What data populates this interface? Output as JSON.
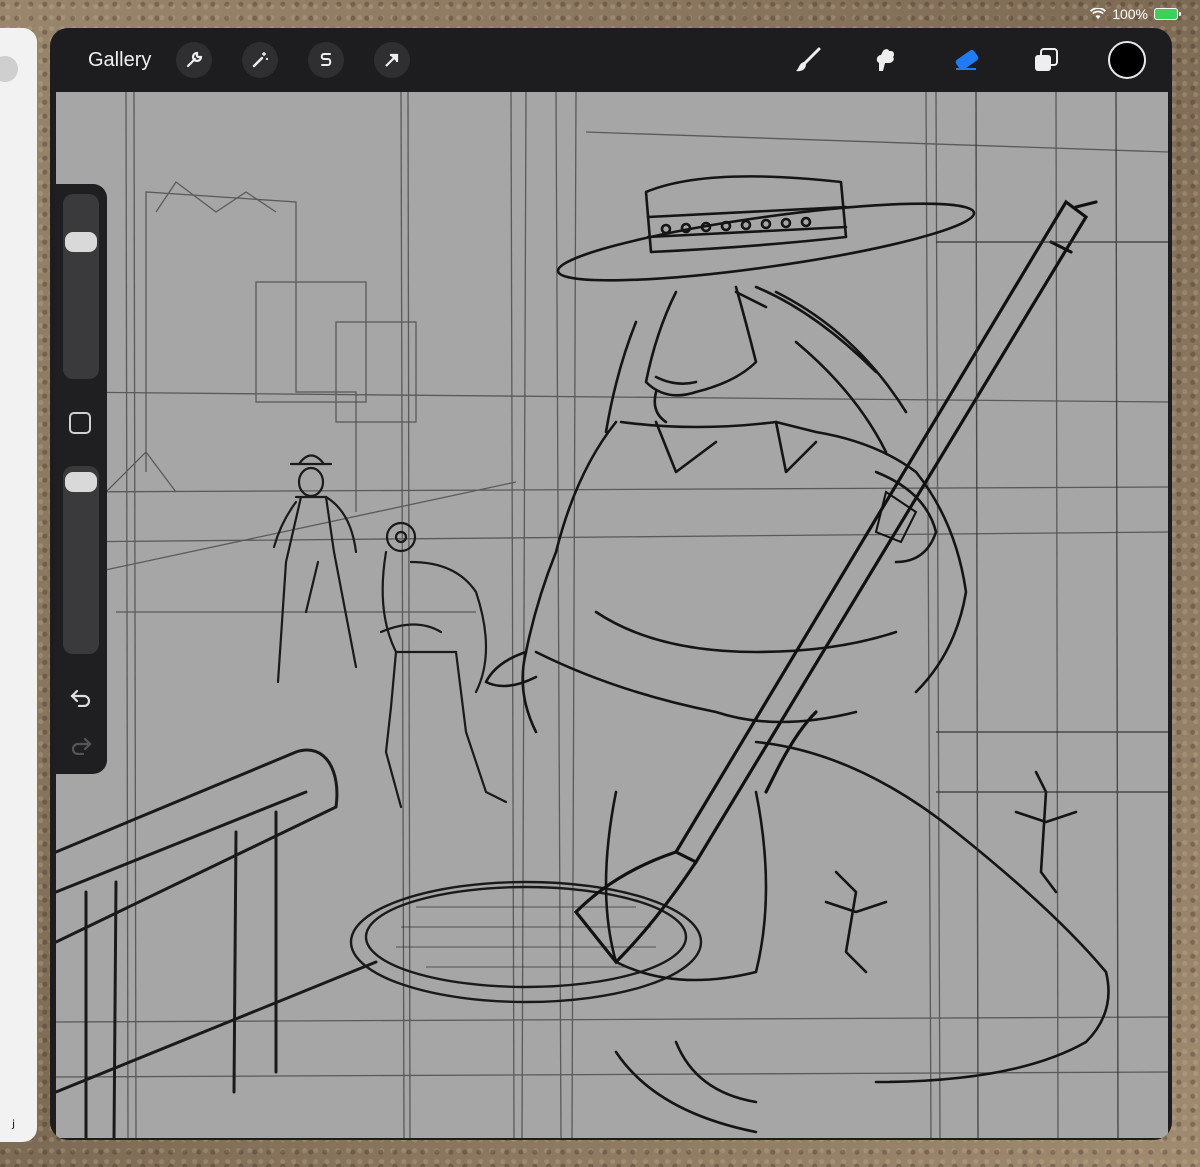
{
  "status_bar": {
    "battery_percent": "100%",
    "wifi_icon": "wifi-icon",
    "battery_icon": "battery-charging-icon"
  },
  "toolbar": {
    "gallery_label": "Gallery",
    "left_tools": [
      {
        "name": "actions-wrench-icon"
      },
      {
        "name": "adjustments-wand-icon"
      },
      {
        "name": "selection-s-icon"
      },
      {
        "name": "transform-arrow-icon"
      }
    ],
    "right_tools": [
      {
        "name": "brush-icon",
        "active": false
      },
      {
        "name": "smudge-icon",
        "active": false
      },
      {
        "name": "eraser-icon",
        "active": true
      },
      {
        "name": "layers-icon",
        "active": false
      }
    ],
    "current_color": "#000000",
    "accent_color": "#1e7cf5"
  },
  "sidebar": {
    "brush_size_icon": "brush-size-slider",
    "modify_icon": "square-modify-icon",
    "opacity_icon": "opacity-slider",
    "undo_icon": "undo-arrow-icon",
    "redo_icon": "redo-arrow-icon"
  },
  "canvas": {
    "description_colors": {
      "paper": "#a6a6a6",
      "ink": "#1a1a1a"
    }
  }
}
